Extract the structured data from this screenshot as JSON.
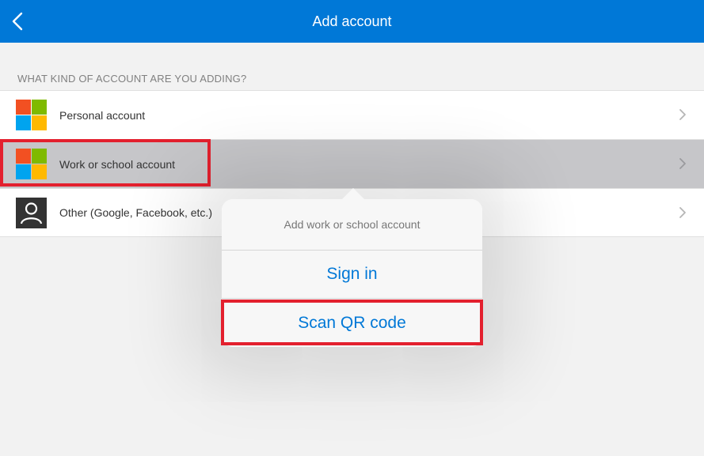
{
  "header": {
    "title": "Add account",
    "back_icon": "chevron-left-icon"
  },
  "section": {
    "header": "WHAT KIND OF ACCOUNT ARE YOU ADDING?"
  },
  "accounts": [
    {
      "label": "Personal account",
      "icon": "microsoft-logo-icon"
    },
    {
      "label": "Work or school account",
      "icon": "microsoft-logo-icon"
    },
    {
      "label": "Other (Google, Facebook, etc.)",
      "icon": "person-icon"
    }
  ],
  "popover": {
    "title": "Add work or school account",
    "actions": [
      "Sign in",
      "Scan QR code"
    ]
  },
  "colors": {
    "accent": "#0078d7",
    "highlight": "#e3202e",
    "ms_red": "#f25022",
    "ms_green": "#7fba00",
    "ms_blue": "#00a4ef",
    "ms_yellow": "#ffb900"
  }
}
